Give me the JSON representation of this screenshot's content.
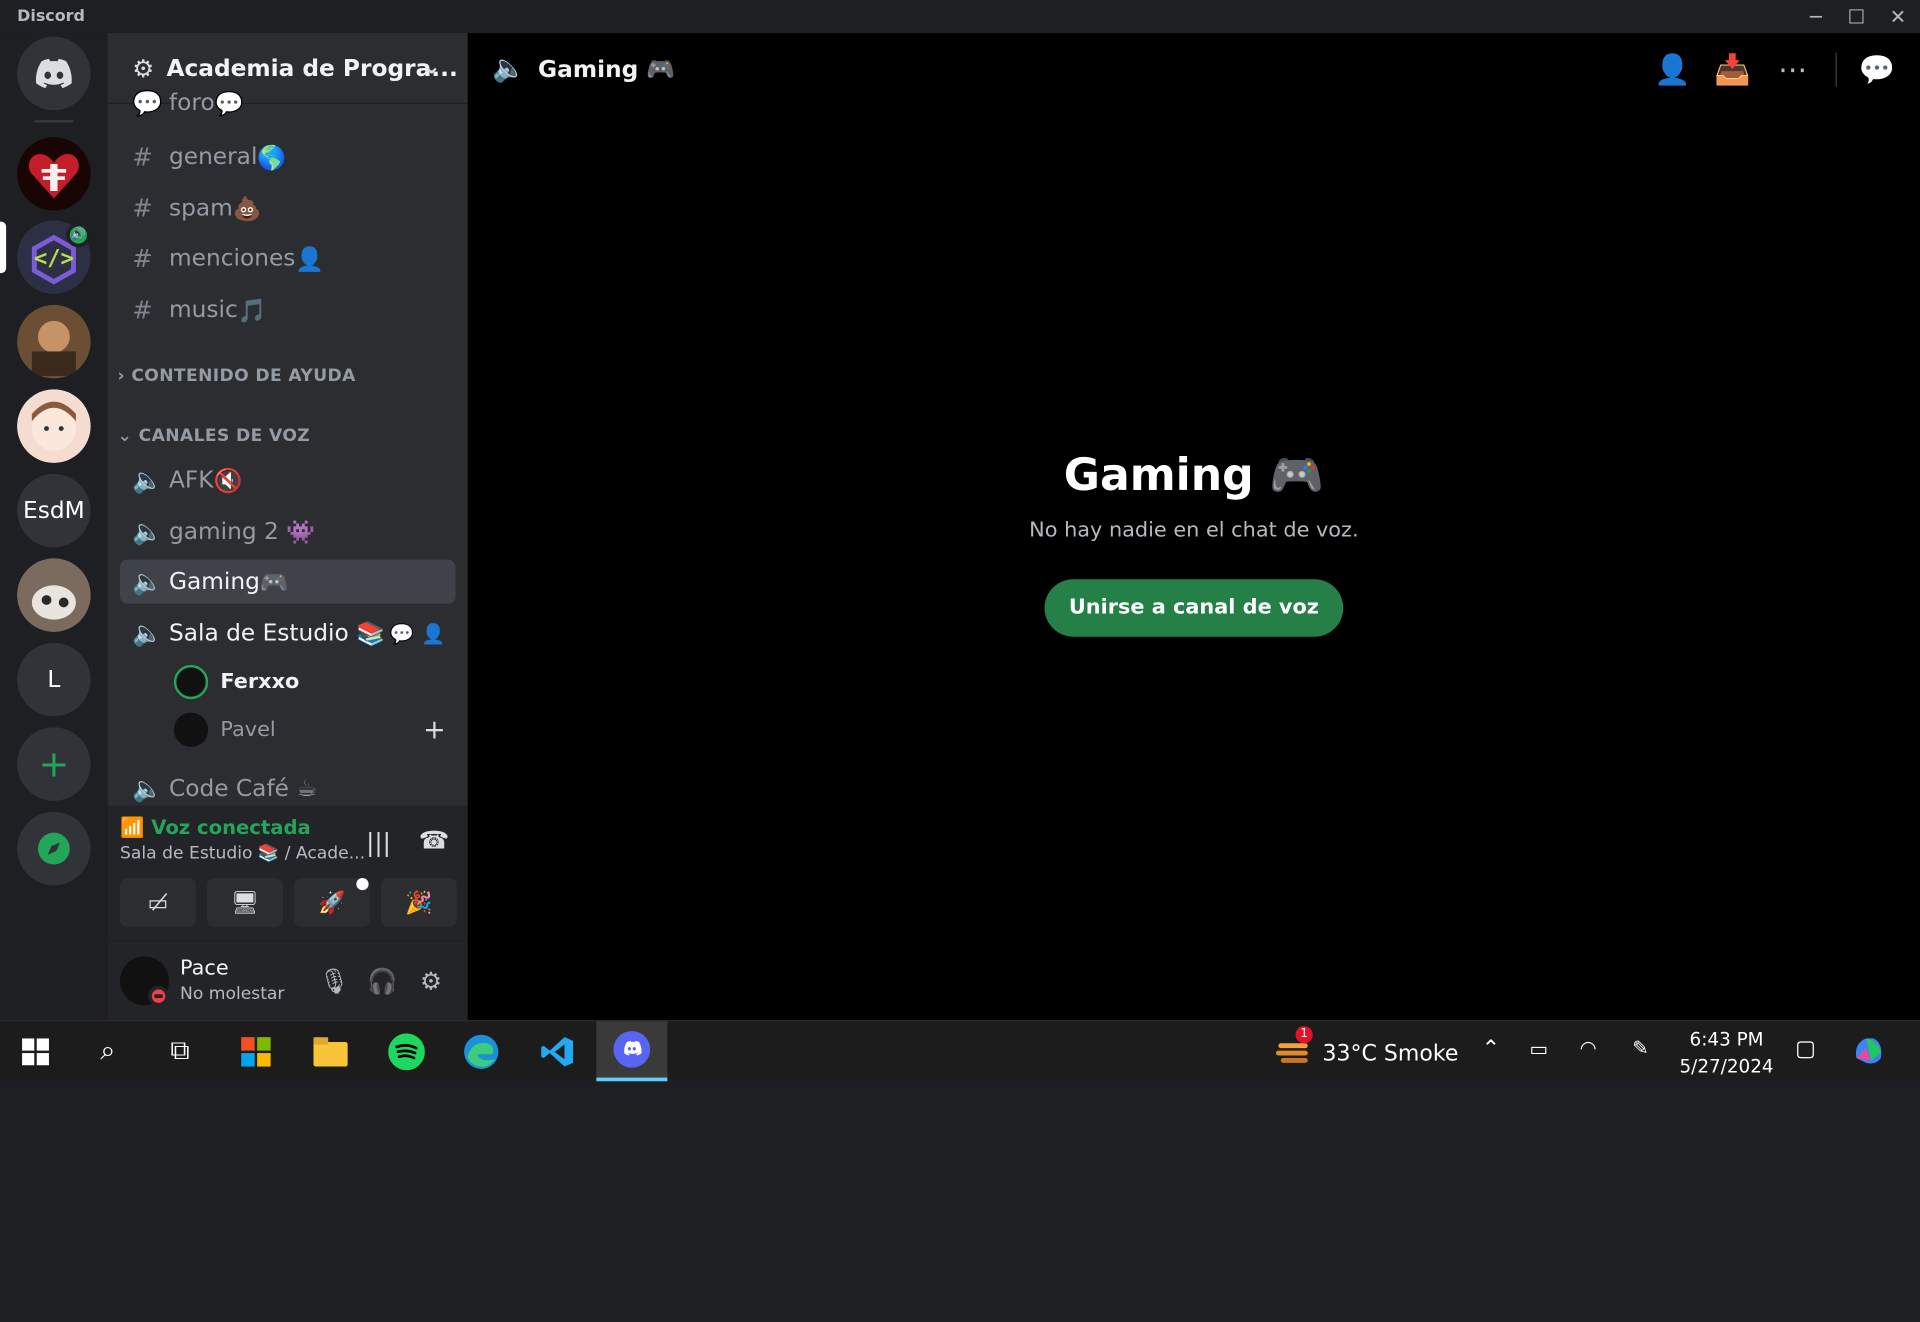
{
  "window": {
    "app_title": "Discord"
  },
  "server": {
    "name": "Academia de Progra..."
  },
  "channels_text": [
    {
      "label": "foro",
      "emoji": "💬"
    },
    {
      "label": "general",
      "emoji": "🌎"
    },
    {
      "label": "spam",
      "emoji": "💩"
    },
    {
      "label": "menciones",
      "emoji": "👤"
    },
    {
      "label": "music",
      "emoji": "🎵"
    }
  ],
  "categories": {
    "help": "CONTENIDO DE AYUDA",
    "voice": "CANALES DE VOZ"
  },
  "channels_voice": [
    {
      "label": "AFK",
      "emoji": "🔇"
    },
    {
      "label": "gaming 2",
      "emoji": "👾"
    },
    {
      "label": "Gaming",
      "emoji": "🎮"
    },
    {
      "label": "Sala de Estudio",
      "emoji": "📚"
    },
    {
      "label": "Code Café",
      "emoji": "☕"
    }
  ],
  "voice_users": [
    {
      "name": "Ferxxo"
    },
    {
      "name": "Pavel"
    }
  ],
  "voice_status": {
    "title": "Voz conectada",
    "subtitle": "Sala de Estudio 📚 / Acade..."
  },
  "user": {
    "name": "Pace",
    "status": "No molestar"
  },
  "main": {
    "channel_title": "Gaming 🎮",
    "heading": "Gaming 🎮",
    "empty_text": "No hay nadie en el chat de voz.",
    "join_button": "Unirse a canal de voz"
  },
  "guilds": {
    "text_server": "EsdM",
    "letter_server": "L"
  },
  "taskbar": {
    "weather": "33°C  Smoke",
    "weather_badge": "1",
    "time": "6:43 PM",
    "date": "5/27/2024"
  },
  "colors": {
    "accent_green": "#248046",
    "online_green": "#23a55a",
    "dnd_red": "#f23f43",
    "sidebar": "#2b2d31"
  },
  "icons": [
    "discord-logo",
    "speaker-icon",
    "hash-icon",
    "gear-icon",
    "chevron-down-icon",
    "add-member-icon",
    "inbox-icon",
    "more-icon",
    "threads-icon",
    "mic-icon",
    "headphones-icon",
    "settings-icon"
  ]
}
